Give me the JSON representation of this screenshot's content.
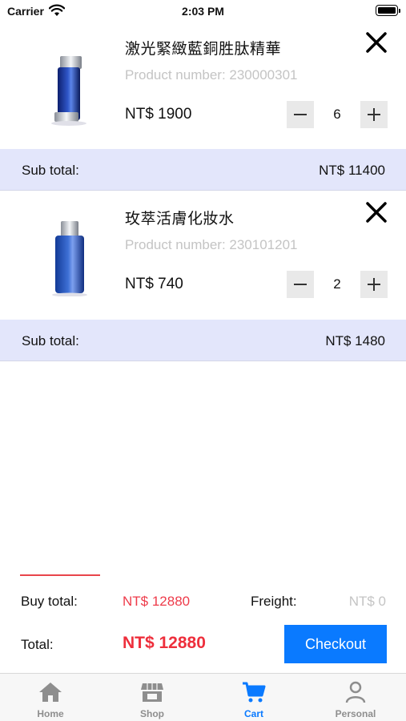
{
  "status_bar": {
    "carrier": "Carrier",
    "time": "2:03 PM"
  },
  "cart": {
    "currency": "NT$",
    "items": [
      {
        "name": "激光緊緻藍銅胜肽精華",
        "product_number": "Product number: 230000301",
        "price": "NT$ 1900",
        "quantity": "6",
        "subtotal_label": "Sub total:",
        "subtotal": "NT$ 11400"
      },
      {
        "name": "玫萃活膚化妝水",
        "product_number": "Product number: 230101201",
        "price": "NT$ 740",
        "quantity": "2",
        "subtotal_label": "Sub total:",
        "subtotal": "NT$ 1480"
      }
    ]
  },
  "summary": {
    "buy_total_label": "Buy total:",
    "buy_total": "NT$ 12880",
    "freight_label": "Freight:",
    "freight": "NT$ 0",
    "total_label": "Total:",
    "total": "NT$ 12880",
    "checkout_label": "Checkout"
  },
  "tab_bar": {
    "tabs": [
      {
        "label": "Home",
        "icon": "home-icon"
      },
      {
        "label": "Shop",
        "icon": "shop-icon"
      },
      {
        "label": "Cart",
        "icon": "cart-icon",
        "active": true
      },
      {
        "label": "Personal",
        "icon": "person-icon"
      }
    ]
  },
  "colors": {
    "accent": "#0a7aff",
    "price_red": "#ee2f3c",
    "subtotal_band": "#e3e6fb",
    "muted_text": "#c4c4c4"
  }
}
